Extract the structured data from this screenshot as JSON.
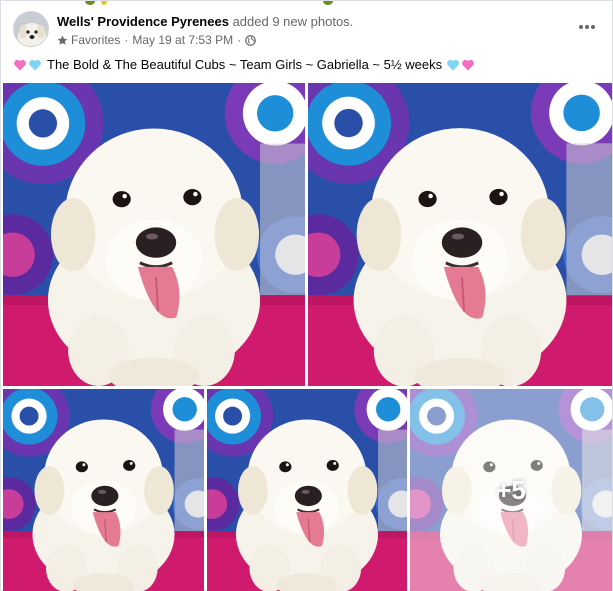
{
  "post": {
    "author": "Wells' Providence Pyrenees",
    "action": "added 9 new photos.",
    "audience_label": "Favorites",
    "separator": "·",
    "timestamp": "May 19 at 7:53 PM",
    "separator2": "·",
    "caption": "The Bold & The Beautiful Cubs ~ Team Girls ~ Gabriella ~ 5½ weeks",
    "more_photos": "+5",
    "colors": {
      "pink_heart": "#f46fbf",
      "blue_heart": "#7fd3f3",
      "secondary_text": "#65676b",
      "blanket_pink": "#d01a6e",
      "backdrop_blue": "#1d63b8",
      "backdrop_purple": "#5a2fa3"
    },
    "icons": [
      "avatar-dog",
      "star-icon",
      "globe-icon",
      "more-options-icon",
      "pink-heart-icon",
      "blue-heart-icon"
    ]
  }
}
